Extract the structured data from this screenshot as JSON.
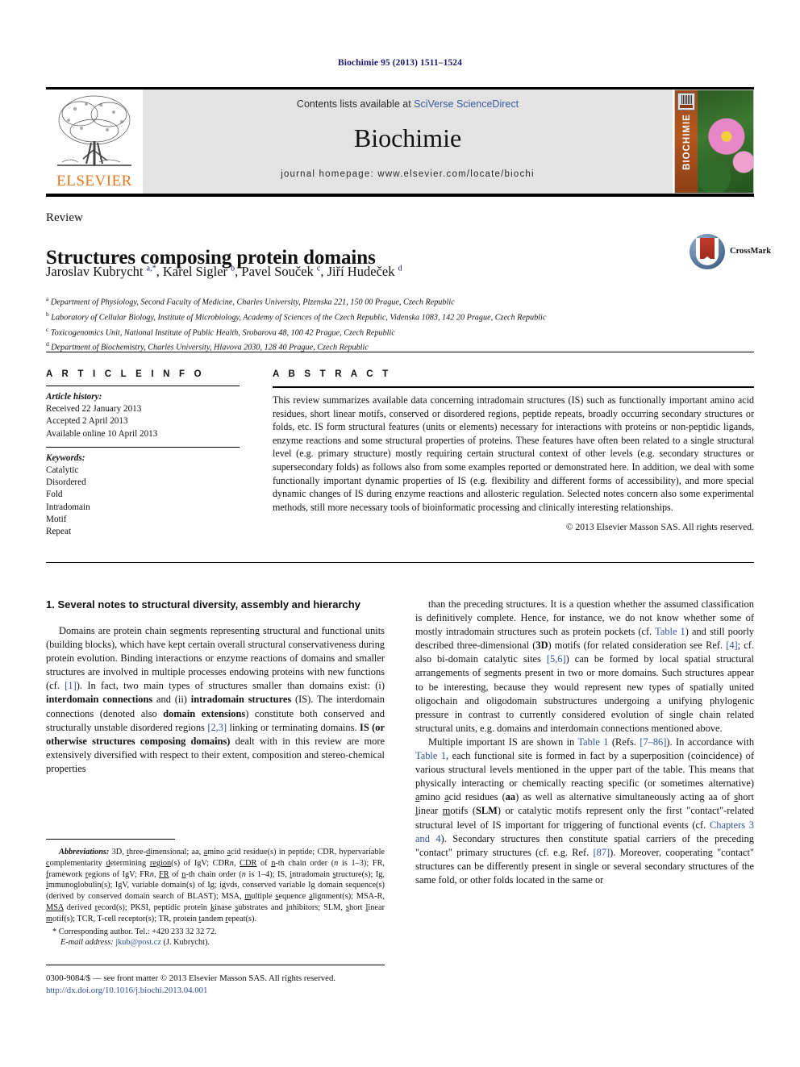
{
  "running_head": "Biochimie 95 (2013) 1511–1524",
  "header": {
    "contents_prefix": "Contents lists available at ",
    "sciencedirect": "SciVerse ScienceDirect",
    "journal_name": "Biochimie",
    "homepage": "journal homepage: www.elsevier.com/locate/biochi",
    "publisher_logo_text": "ELSEVIER",
    "cover_spine_title": "BIOCHIMIE"
  },
  "article": {
    "doctype": "Review",
    "title": "Structures composing protein domains",
    "authors_html": "Jaroslav Kubrycht <sup>a,*</sup>, Karel Sigler <sup>b</sup>, Pavel Souček <sup>c</sup>, Jiří Hudeček <sup>d</sup>",
    "crossmark_label": "CrossMark",
    "affiliations": [
      "Department of Physiology, Second Faculty of Medicine, Charles University, Plzenska 221, 150 00 Prague, Czech Republic",
      "Laboratory of Cellular Biology, Institute of Microbiology, Academy of Sciences of the Czech Republic, Videnska 1083, 142 20 Prague, Czech Republic",
      "Toxicogenomics Unit, National Institute of Public Health, Srobarova 48, 100 42 Prague, Czech Republic",
      "Department of Biochemistry, Charles University, Hlavova 2030, 128 40 Prague, Czech Republic"
    ],
    "affiliation_marks": [
      "a",
      "b",
      "c",
      "d"
    ]
  },
  "article_info": {
    "heading": "A R T I C L E   I N F O",
    "history_label": "Article history:",
    "history": [
      "Received 22 January 2013",
      "Accepted 2 April 2013",
      "Available online 10 April 2013"
    ],
    "keywords_label": "Keywords:",
    "keywords": [
      "Catalytic",
      "Disordered",
      "Fold",
      "Intradomain",
      "Motif",
      "Repeat"
    ]
  },
  "abstract": {
    "heading": "A B S T R A C T",
    "text": "This review summarizes available data concerning intradomain structures (IS) such as functionally important amino acid residues, short linear motifs, conserved or disordered regions, peptide repeats, broadly occurring secondary structures or folds, etc. IS form structural features (units or elements) necessary for interactions with proteins or non-peptidic ligands, enzyme reactions and some structural properties of proteins. These features have often been related to a single structural level (e.g. primary structure) mostly requiring certain structural context of other levels (e.g. secondary structures or supersecondary folds) as follows also from some examples reported or demonstrated here. In addition, we deal with some functionally important dynamic properties of IS (e.g. flexibility and different forms of accessibility), and more special dynamic changes of IS during enzyme reactions and allosteric regulation. Selected notes concern also some experimental methods, still more necessary tools of bioinformatic processing and clinically interesting relationships.",
    "copyright": "© 2013 Elsevier Masson SAS. All rights reserved."
  },
  "body": {
    "section_number_title": "1. Several notes to structural diversity, assembly and hierarchy",
    "left_paragraph_1_html": "Domains are protein chain segments representing structural and functional units (building blocks), which have kept certain overall structural conservativeness during protein evolution. Binding interactions or enzyme reactions of domains and smaller structures are involved in multiple processes endowing proteins with new functions (cf. <span class=\"ref\">[1]</span>). In fact, two main types of structures smaller than domains exist: (i) <b>interdomain connections</b> and (ii) <b>intradomain structures</b> (IS). The interdomain connections (denoted also <b>domain extensions</b>) constitute both conserved and structurally unstable disordered regions <span class=\"ref\">[2,3]</span> linking or terminating domains. <b>IS (or otherwise structures composing domains)</b> dealt with in this review are more extensively diversified with respect to their extent, composition and stereo-chemical properties",
    "right_paragraph_1_html": "than the preceding structures. It is a question whether the assumed classification is definitively complete. Hence, for instance, we do not know whether some of mostly intradomain structures such as protein pockets (cf. <span class=\"ref\">Table 1</span>) and still poorly described three-dimensional (<b>3D</b>) motifs (for related consideration see Ref. <span class=\"ref\">[4]</span>; cf. also bi-domain catalytic sites <span class=\"ref\">[5,6]</span>) can be formed by local spatial structural arrangements of segments present in two or more domains. Such structures appear to be interesting, because they would represent new types of spatially united oligochain and oligodomain substructures undergoing a unifying phylogenic pressure in contrast to currently considered evolution of single chain related structural units, e.g. domains and interdomain connections mentioned above.",
    "right_paragraph_2_html": "Multiple important IS are shown in <span class=\"ref\">Table 1</span> (Refs. <span class=\"ref\">[7–86]</span>). In accordance with <span class=\"ref\">Table 1</span>, each functional site is formed in fact by a superposition (coincidence) of various structural levels mentioned in the upper part of the table. This means that physically interacting or chemically reacting specific (or sometimes alternative) <u>a</u>mino <u>a</u>cid residues (<b>aa</b>) as well as alternative simultaneously acting aa of <u>s</u>hort <u>l</u>inear <u>m</u>otifs (<b>SLM</b>) or catalytic motifs represent only the first \"contact\"-related structural level of IS important for triggering of functional events (cf. <span class=\"ref\">Chapters 3 and 4</span>). Secondary structures then constitute spatial carriers of the preceding \"contact\" primary structures (cf. e.g. Ref. <span class=\"ref\">[87]</span>). Moreover, cooperating \"contact\" structures can be differently present in single or several secondary structures of the same fold, or other folds located in the same or"
  },
  "footnote": {
    "abbreviations_label": "Abbreviations:",
    "abbreviations_html": "3D, <u>t</u>hree-<u>d</u>imensional; aa, <u>a</u>mino <u>a</u>cid residue(s) in peptide; CDR, hypervariable <u>c</u>omplementarity <u>d</u>etermining <u>region</u>(s) of IgV; CDR<i>n</i>, <u>CDR</u> of <u>n</u>-th chain order (<i>n</i> is 1–3); FR, <u>f</u>ramework <u>r</u>egions of IgV; FR<i>n</i>, <u>FR</u> of <u>n</u>-th chain order (<i>n</i> is 1–4); IS, <u>i</u>ntradomain <u>s</u>tructure(s); Ig, <u>i</u>mmunoglobulin(s); IgV, variable domain(s) of Ig; igvds, conserved variable Ig domain sequence(s) (derived by conserved domain search of BLAST); MSA, <u>m</u>ultiple <u>s</u>equence <u>a</u>lignment(s); MSA-R, <u>MSA</u> derived <u>r</u>ecord(s); PKSI, peptidic protein <u>k</u>inase <u>s</u>ubstrates and <u>i</u>nhibitors; SLM, <u>s</u>hort <u>l</u>inear <u>m</u>otif(s); TCR, T-cell receptor(s); TR, protein <u>t</u>andem <u>r</u>epeat(s).",
    "corresponding": "* Corresponding author. Tel.: +420 233 32 32 72.",
    "email_label": "E-mail address:",
    "email": "jkub@post.cz",
    "email_person": "(J. Kubrycht)."
  },
  "footer": {
    "issn_line": "0300-9084/$ — see front matter © 2013 Elsevier Masson SAS. All rights reserved.",
    "doi": "http://dx.doi.org/10.1016/j.biochi.2013.04.001"
  },
  "colors": {
    "link": "#2e4f9e",
    "running_head": "#1a1a6e",
    "elsevier_orange": "#E87722",
    "header_band": "#e3e3e3"
  }
}
